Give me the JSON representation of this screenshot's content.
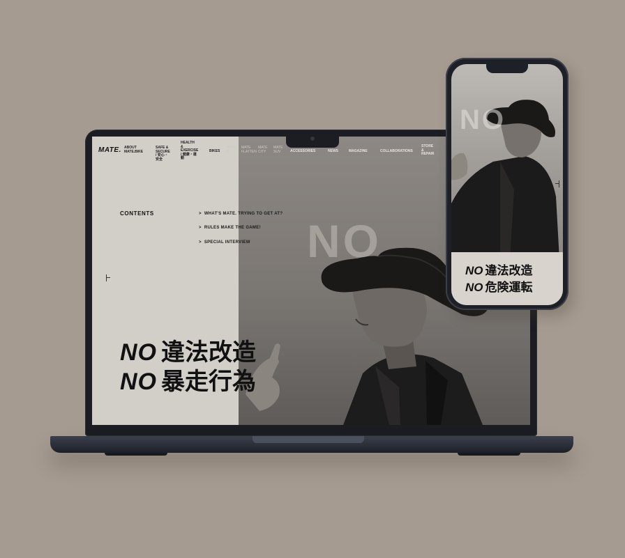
{
  "colors": {
    "background": "#a59b91",
    "screen_left": "#d2cec8",
    "photo": "#7a7672",
    "text": "#111111",
    "device": "#1c1d22"
  },
  "laptop": {
    "nav": {
      "logo": "MATE.",
      "items": [
        "ABOUT\nMATE.BIKE",
        "SAFE &\nSECURE\n/ 安心・\n安全",
        "HEALTH\n&\nEXERCISE\n/ 健康・運\n動",
        "BIKES",
        "MATE\nX",
        "MATE\nFlatten",
        "MATE\nCity",
        "MATE\nSUV",
        "ACCESSORIES",
        "NEWS",
        "MAGAZINE",
        "COLLABORATIONS",
        "STORE\n&\nREPAIR"
      ]
    },
    "contents_title": "CONTENTS",
    "toc": [
      {
        "arrow": ">",
        "label": "WHAT'S MATE. TRYING TO GET AT?"
      },
      {
        "arrow": ">",
        "label": "RULES MAKE THE GAME!"
      },
      {
        "arrow": ">",
        "label": "SPECIAL INTERVIEW"
      }
    ],
    "background_word": "NO",
    "hero": [
      {
        "no": "NO",
        "zh": "違法改造"
      },
      {
        "no": "NO",
        "zh": "暴走行為"
      }
    ]
  },
  "phone": {
    "background_word": "NO",
    "hero": [
      {
        "no": "NO",
        "zh": "違法改造"
      },
      {
        "no": "NO",
        "zh": "危険運転"
      }
    ]
  }
}
